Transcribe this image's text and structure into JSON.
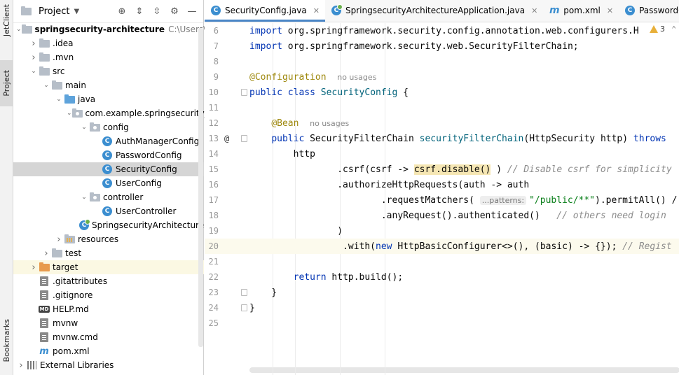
{
  "side_strip": {
    "jetclient": "JetClient",
    "project": "Project",
    "bookmarks": "Bookmarks"
  },
  "project_panel": {
    "title": "Project"
  },
  "tree": [
    {
      "label": "springsecurity-architecture",
      "suffix": "C:\\Users\\nool",
      "indent": 0,
      "arrow": "down",
      "icon": "folder"
    },
    {
      "label": ".idea",
      "indent": 1,
      "arrow": "right",
      "icon": "folder"
    },
    {
      "label": ".mvn",
      "indent": 1,
      "arrow": "right",
      "icon": "folder"
    },
    {
      "label": "src",
      "indent": 1,
      "arrow": "down",
      "icon": "folder"
    },
    {
      "label": "main",
      "indent": 2,
      "arrow": "down",
      "icon": "folder"
    },
    {
      "label": "java",
      "indent": 3,
      "arrow": "down",
      "icon": "folder-blue"
    },
    {
      "label": "com.example.springsecurity_a",
      "indent": 4,
      "arrow": "down",
      "icon": "package"
    },
    {
      "label": "config",
      "indent": 5,
      "arrow": "down",
      "icon": "package"
    },
    {
      "label": "AuthManagerConfig",
      "indent": 6,
      "arrow": "",
      "icon": "class"
    },
    {
      "label": "PasswordConfig",
      "indent": 6,
      "arrow": "",
      "icon": "class"
    },
    {
      "label": "SecurityConfig",
      "indent": 6,
      "arrow": "",
      "icon": "class"
    },
    {
      "label": "UserConfig",
      "indent": 6,
      "arrow": "",
      "icon": "class"
    },
    {
      "label": "controller",
      "indent": 5,
      "arrow": "down",
      "icon": "package"
    },
    {
      "label": "UserController",
      "indent": 6,
      "arrow": "",
      "icon": "class"
    },
    {
      "label": "SpringsecurityArchitecture",
      "indent": 5,
      "arrow": "",
      "icon": "boot-class"
    },
    {
      "label": "resources",
      "indent": 3,
      "arrow": "right",
      "icon": "resources"
    },
    {
      "label": "test",
      "indent": 2,
      "arrow": "right",
      "icon": "folder"
    },
    {
      "label": "target",
      "indent": 1,
      "arrow": "right",
      "icon": "folder-orange"
    },
    {
      "label": ".gitattributes",
      "indent": 1,
      "arrow": "",
      "icon": "file"
    },
    {
      "label": ".gitignore",
      "indent": 1,
      "arrow": "",
      "icon": "file"
    },
    {
      "label": "HELP.md",
      "indent": 1,
      "arrow": "",
      "icon": "md"
    },
    {
      "label": "mvnw",
      "indent": 1,
      "arrow": "",
      "icon": "file"
    },
    {
      "label": "mvnw.cmd",
      "indent": 1,
      "arrow": "",
      "icon": "file"
    },
    {
      "label": "pom.xml",
      "indent": 1,
      "arrow": "",
      "icon": "maven"
    },
    {
      "label": "External Libraries",
      "indent": 0,
      "arrow": "right",
      "icon": "libs"
    }
  ],
  "tabs": [
    {
      "label": "SecurityConfig.java",
      "icon": "class",
      "active": true,
      "closable": true
    },
    {
      "label": "SpringsecurityArchitectureApplication.java",
      "icon": "boot-class",
      "active": false,
      "closable": true
    },
    {
      "label": "pom.xml",
      "icon": "maven",
      "active": false,
      "closable": true
    },
    {
      "label": "PasswordConfig.ja",
      "icon": "class",
      "active": false,
      "closable": false
    }
  ],
  "warnings": {
    "count": "3"
  },
  "code_lines": [
    {
      "n": "6",
      "tokens": [
        [
          "kw",
          "import "
        ],
        [
          "",
          "org.springframework.security.config.annotation.web.configurers.H"
        ]
      ]
    },
    {
      "n": "7",
      "tokens": [
        [
          "kw",
          "import "
        ],
        [
          "",
          "org.springframework.security.web.SecurityFilterChain;"
        ]
      ]
    },
    {
      "n": "8",
      "tokens": []
    },
    {
      "n": "9",
      "tokens": [
        [
          "ann",
          "@Configuration"
        ],
        [
          "",
          "  "
        ],
        [
          "hint",
          "no usages"
        ]
      ]
    },
    {
      "n": "10",
      "tokens": [
        [
          "kw",
          "public class "
        ],
        [
          "cname",
          "SecurityConfig"
        ],
        [
          "",
          " {"
        ]
      ]
    },
    {
      "n": "11",
      "tokens": []
    },
    {
      "n": "12",
      "tokens": [
        [
          "",
          "    "
        ],
        [
          "ann",
          "@Bean"
        ],
        [
          "",
          "  "
        ],
        [
          "hint",
          "no usages"
        ]
      ]
    },
    {
      "n": "13",
      "gutter": "@",
      "tokens": [
        [
          "",
          "    "
        ],
        [
          "kw",
          "public "
        ],
        [
          "",
          "SecurityFilterChain "
        ],
        [
          "method",
          "securityFilterChain"
        ],
        [
          "",
          "(HttpSecurity http) "
        ],
        [
          "kw",
          "throws"
        ]
      ]
    },
    {
      "n": "14",
      "tokens": [
        [
          "",
          "        http"
        ]
      ]
    },
    {
      "n": "15",
      "tokens": [
        [
          "",
          "                .csrf(csrf -> "
        ],
        [
          "match",
          "csrf.disable()"
        ],
        [
          "",
          " ) "
        ],
        [
          "cmt",
          "// Disable csrf for simplicity"
        ]
      ]
    },
    {
      "n": "16",
      "tokens": [
        [
          "",
          "                .authorizeHttpRequests(auth -> auth"
        ]
      ]
    },
    {
      "n": "17",
      "tokens": [
        [
          "",
          "                        .requestMatchers( "
        ],
        [
          "inlay",
          "...patterns:"
        ],
        [
          "str",
          "\"/public/**\""
        ],
        [
          "",
          ").permitAll() /"
        ]
      ]
    },
    {
      "n": "18",
      "tokens": [
        [
          "",
          "                        .anyRequest().authenticated()   "
        ],
        [
          "cmt",
          "// others need login"
        ]
      ]
    },
    {
      "n": "19",
      "tokens": [
        [
          "",
          "                )"
        ]
      ]
    },
    {
      "n": "20",
      "current": true,
      "tokens": [
        [
          "",
          "                 .with("
        ],
        [
          "kw",
          "new "
        ],
        [
          "",
          "HttpBasicConfigurer<>(), (basic) -> {}); "
        ],
        [
          "cmt",
          "// Regist"
        ]
      ]
    },
    {
      "n": "21",
      "tokens": []
    },
    {
      "n": "22",
      "tokens": [
        [
          "",
          "        "
        ],
        [
          "kw",
          "return "
        ],
        [
          "",
          "http.build();"
        ]
      ]
    },
    {
      "n": "23",
      "tokens": [
        [
          "",
          "    }"
        ]
      ]
    },
    {
      "n": "24",
      "tokens": [
        [
          "",
          "}"
        ]
      ]
    },
    {
      "n": "25",
      "tokens": []
    }
  ]
}
